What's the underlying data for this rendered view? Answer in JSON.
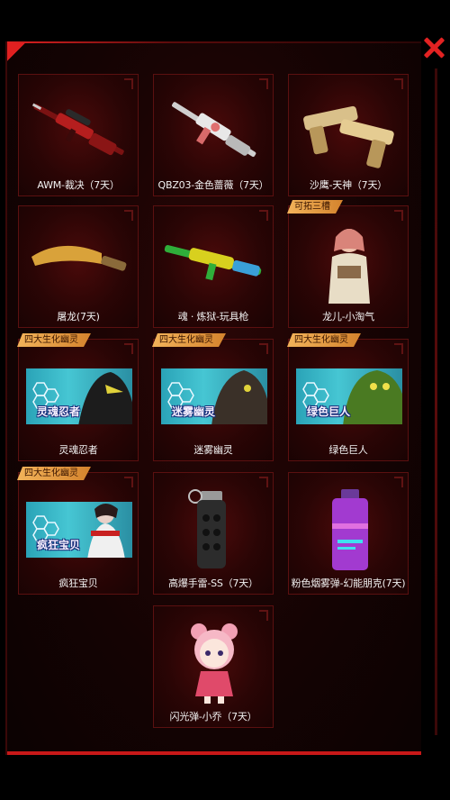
{
  "items": [
    {
      "name": "AWM-裁决（7天）",
      "tag": "",
      "icon": "sniper-rifle-icon"
    },
    {
      "name": "QBZ03-金色蔷薇（7天）",
      "tag": "",
      "icon": "assault-rifle-icon"
    },
    {
      "name": "沙鹰-天神（7天）",
      "tag": "",
      "icon": "dual-pistols-icon"
    },
    {
      "name": "屠龙(7天)",
      "tag": "",
      "icon": "machete-icon"
    },
    {
      "name": "魂 · 炼狱-玩具枪",
      "tag": "",
      "icon": "toy-gun-icon"
    },
    {
      "name": "龙儿-小淘气",
      "tag": "可拓三槽",
      "icon": "female-character-icon"
    },
    {
      "name": "灵魂忍者",
      "tag": "四大生化幽灵",
      "banner": "灵魂忍者",
      "icon": "ghost-ninja-icon"
    },
    {
      "name": "迷雾幽灵",
      "tag": "四大生化幽灵",
      "banner": "迷雾幽灵",
      "icon": "mist-ghost-icon"
    },
    {
      "name": "绿色巨人",
      "tag": "四大生化幽灵",
      "banner": "绿色巨人",
      "icon": "green-giant-icon"
    },
    {
      "name": "疯狂宝贝",
      "tag": "四大生化幽灵",
      "banner": "疯狂宝贝",
      "icon": "crazy-baby-icon"
    },
    {
      "name": "高爆手雷-SS（7天）",
      "tag": "",
      "icon": "grenade-icon"
    },
    {
      "name": "粉色烟雾弹-幻能朋克(7天)",
      "tag": "",
      "icon": "smoke-grenade-icon"
    },
    {
      "name": "闪光弹-小乔（7天）",
      "tag": "",
      "icon": "chibi-doll-icon"
    }
  ],
  "colors": {
    "accent": "#e02020",
    "tag_bg": "#e8a04a",
    "card_bg": "#2a0505",
    "banner": "#3fb8c8"
  }
}
